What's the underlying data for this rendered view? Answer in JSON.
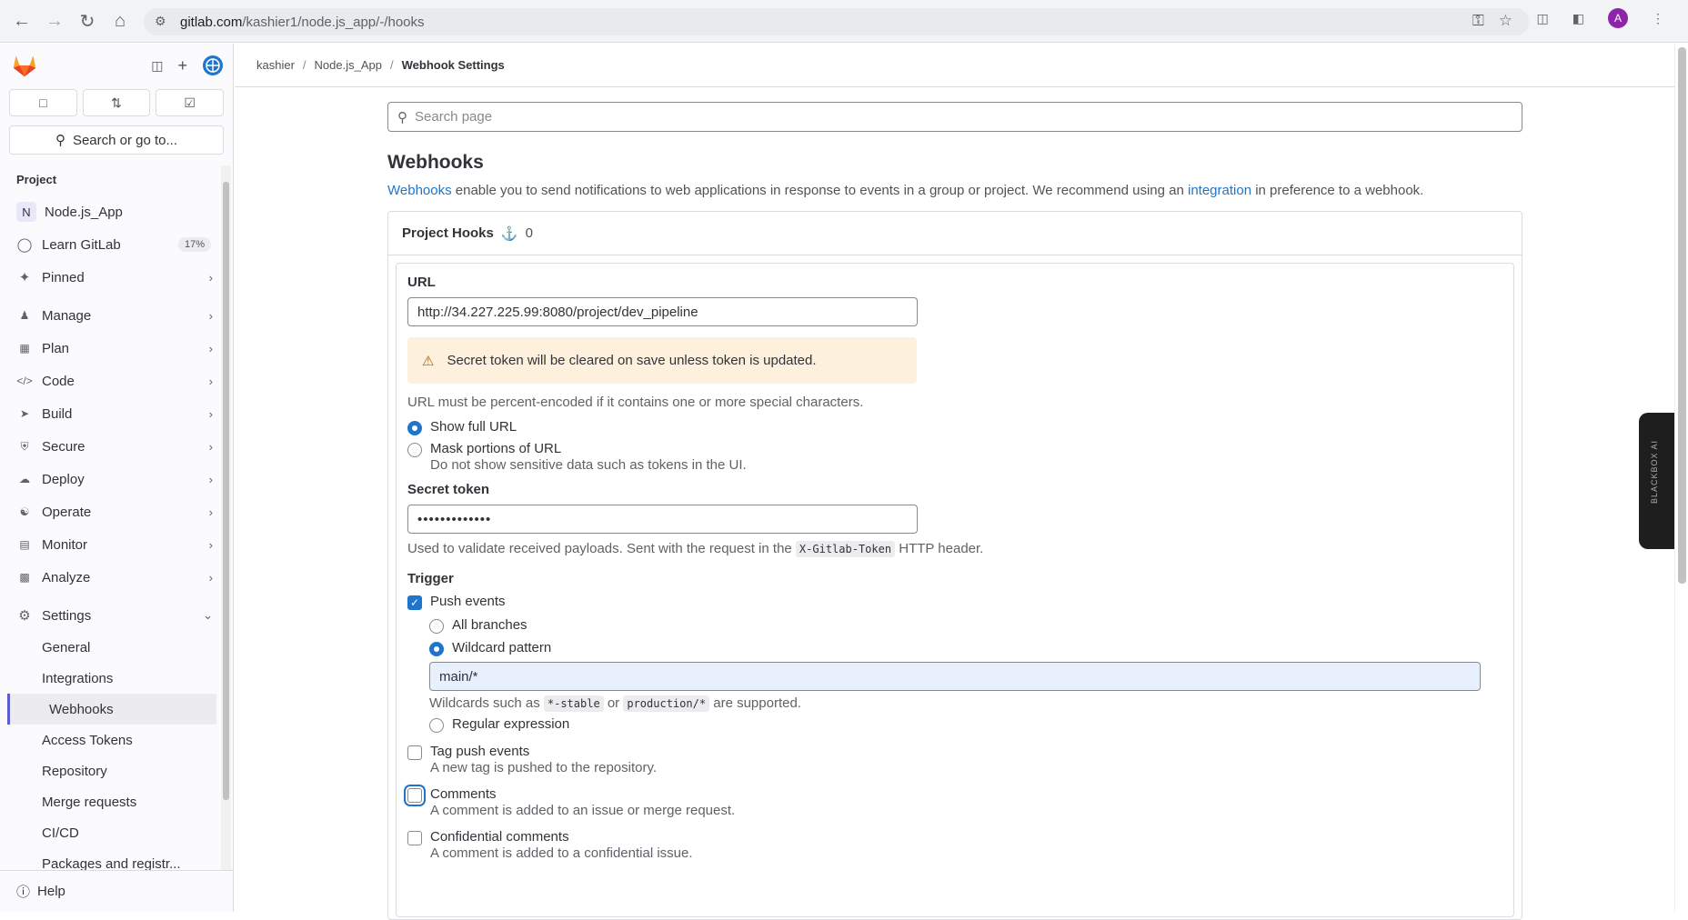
{
  "browser": {
    "url_host": "gitlab.com",
    "url_path": "/kashier1/node.js_app/-/hooks",
    "avatar_letter": "A"
  },
  "sidebar": {
    "search_label": "Search or go to...",
    "section_title": "Project",
    "project_initial": "N",
    "project_name": "Node.js_App",
    "learn_label": "Learn GitLab",
    "learn_badge": "17%",
    "pinned_label": "Pinned",
    "nav": [
      {
        "label": "Manage",
        "icon": "users-icon"
      },
      {
        "label": "Plan",
        "icon": "calendar-icon"
      },
      {
        "label": "Code",
        "icon": "code-icon"
      },
      {
        "label": "Build",
        "icon": "rocket-icon"
      },
      {
        "label": "Secure",
        "icon": "shield-icon"
      },
      {
        "label": "Deploy",
        "icon": "deploy-icon"
      },
      {
        "label": "Operate",
        "icon": "operate-icon"
      },
      {
        "label": "Monitor",
        "icon": "monitor-icon"
      },
      {
        "label": "Analyze",
        "icon": "chart-icon"
      }
    ],
    "settings_label": "Settings",
    "settings_items": [
      "General",
      "Integrations",
      "Webhooks",
      "Access Tokens",
      "Repository",
      "Merge requests",
      "CI/CD",
      "Packages and registr..."
    ],
    "help_label": "Help"
  },
  "breadcrumb": {
    "items": [
      "kashier",
      "Node.js_App"
    ],
    "current": "Webhook Settings"
  },
  "main": {
    "search_placeholder": "Search page",
    "title": "Webhooks",
    "desc_link1": "Webhooks",
    "desc_mid": " enable you to send notifications to web applications in response to events in a group or project. We recommend using an ",
    "desc_link2": "integration",
    "desc_end": " in preference to a webhook.",
    "hooks_title": "Project Hooks",
    "hooks_count": "0"
  },
  "form": {
    "url_label": "URL",
    "url_value": "http://34.227.225.99:8080/project/dev_pipeline",
    "alert_text": "Secret token will be cleared on save unless token is updated.",
    "url_help": "URL must be percent-encoded if it contains one or more special characters.",
    "show_full_url": "Show full URL",
    "mask_url": "Mask portions of URL",
    "mask_help": "Do not show sensitive data such as tokens in the UI.",
    "secret_label": "Secret token",
    "secret_value": "•••••••••••••",
    "secret_help_pre": "Used to validate received payloads. Sent with the request in the ",
    "secret_help_code": "X-Gitlab-Token",
    "secret_help_post": " HTTP header.",
    "trigger_label": "Trigger",
    "push_events": "Push events",
    "all_branches": "All branches",
    "wildcard_pattern": "Wildcard pattern",
    "wildcard_value": "main/*",
    "wild_help_pre": "Wildcards such as ",
    "wild_code1": "*-stable",
    "wild_help_mid": " or ",
    "wild_code2": "production/*",
    "wild_help_post": " are supported.",
    "regex": "Regular expression",
    "tag_push": "Tag push events",
    "tag_push_help": "A new tag is pushed to the repository.",
    "comments": "Comments",
    "comments_help": "A comment is added to an issue or merge request.",
    "conf_comments": "Confidential comments",
    "conf_comments_help": "A comment is added to a confidential issue."
  },
  "blackbox": "BLACKBOX AI"
}
